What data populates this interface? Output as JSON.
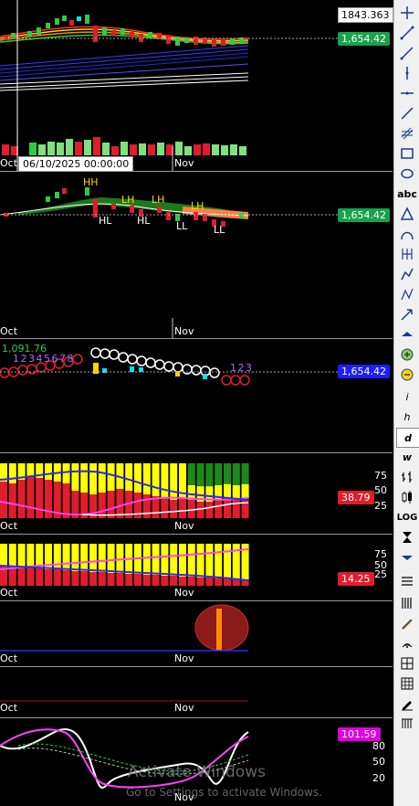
{
  "top_value": "1843.363",
  "date_tooltip": "06/10/2025 00:00:00",
  "months": {
    "oct": "Oct",
    "nov": "Nov"
  },
  "price_badges": {
    "panel1": "1,654.42",
    "panel2": "1,654.42",
    "panel3": "1,654.42",
    "panel4": "38.79",
    "panel5": "14.25",
    "panel8": "101.59"
  },
  "panel3_label": "1,091.76",
  "panel3_counts_left": "1 2 3 4 5 6 7 8",
  "panel3_counts_right": "1 2 3",
  "swing_labels": {
    "hh": "HH",
    "lh1": "LH",
    "lh2": "LH",
    "hl1": "HL",
    "hl2": "HL",
    "ll1": "LL",
    "ll2": "LL",
    "lh3": "LH"
  },
  "scales": {
    "p4": [
      "75",
      "50",
      "25"
    ],
    "p5": [
      "75",
      "50",
      "25"
    ],
    "p8": [
      "80",
      "50",
      "20"
    ]
  },
  "toolbar_text": {
    "abc": "abc",
    "w": "w",
    "i": "i",
    "h": "h",
    "d": "d",
    "log": "LOG"
  },
  "watermark": {
    "line1": "Activate Windows",
    "line2": "Go to Settings to activate Windows."
  },
  "colors": {
    "green_badge": "#16a34a",
    "blue_badge": "#1d1dff",
    "red_badge": "#e11d2b",
    "magenta_badge": "#e000e0"
  }
}
